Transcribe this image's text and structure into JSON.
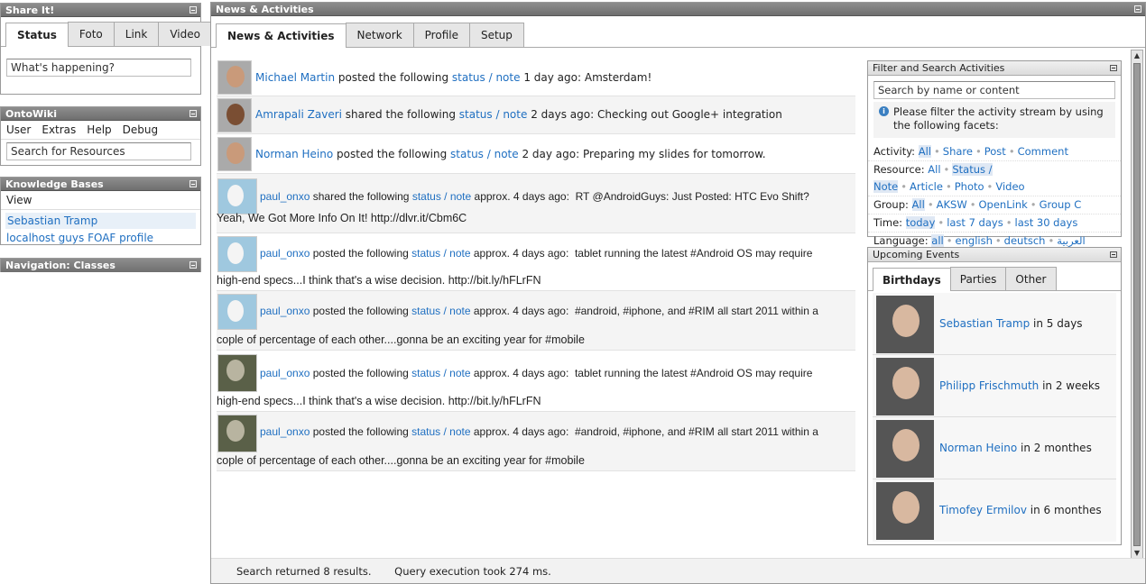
{
  "share": {
    "title": "Share It!",
    "tabs": [
      "Status",
      "Foto",
      "Link",
      "Video"
    ],
    "input_value": "What's happening?"
  },
  "ontowiki": {
    "title": "OntoWiki",
    "menu": [
      "User",
      "Extras",
      "Help",
      "Debug"
    ],
    "search_value": "Search for Resources"
  },
  "kb": {
    "title": "Knowledge Bases",
    "view": "View",
    "items": [
      "Sebastian Tramp",
      "localhost guys FOAF profile"
    ]
  },
  "nav": {
    "title": "Navigation: Classes"
  },
  "news": {
    "title": "News & Activities",
    "tabs": [
      "News & Activities",
      "Network",
      "Profile",
      "Setup"
    ],
    "feed": [
      {
        "user": "Michael Martin",
        "verb": "posted the following",
        "link": "status / note",
        "time": "1 day ago:",
        "text": "Amsterdam!"
      },
      {
        "user": "Amrapali Zaveri",
        "verb": "shared the following",
        "link": "status / note",
        "time": "2 days ago:",
        "text": "Checking out Google+ integration"
      },
      {
        "user": "Norman Heino",
        "verb": "posted the following",
        "link": "status / note",
        "time": "2 day ago:",
        "text": "Preparing my slides for tomorrow."
      },
      {
        "user": "paul_onxo",
        "verb": "shared the following",
        "link": "status / note",
        "time": "approx. 4 days ago:",
        "text": "RT @AndroidGuys: Just Posted: HTC Evo Shift?",
        "text2": "Yeah, We Got More Info On It! http://dlvr.it/Cbm6C"
      },
      {
        "user": "paul_onxo",
        "verb": "posted the following",
        "link": "status / note",
        "time": "approx. 4 days ago:",
        "text": "tablet running the latest #Android OS may require",
        "text2": "high-end specs...I think that's a wise decision. http://bit.ly/hFLrFN"
      },
      {
        "user": "paul_onxo",
        "verb": "posted the following",
        "link": "status / note",
        "time": "approx. 4 days ago:",
        "text": "#android, #iphone, and #RIM all start 2011 within a",
        "text2": "cople of percentage of each other....gonna be an exciting year for #mobile"
      },
      {
        "user": "paul_onxo",
        "verb": "posted the following",
        "link": "status / note",
        "time": "approx. 4  days ago:",
        "text": "tablet running the latest #Android OS may require",
        "text2": "high-end specs...I think that's a wise decision. http://bit.ly/hFLrFN"
      },
      {
        "user": "paul_onxo",
        "verb": "posted the following",
        "link": "status / note",
        "time": "approx. 4 days ago:",
        "text": "#android, #iphone, and #RIM all start 2011 within a",
        "text2": "cople of percentage of each other....gonna be an exciting year for #mobile"
      }
    ],
    "status": {
      "results": "Search returned 8 results.",
      "query": "Query execution took 274 ms."
    }
  },
  "filter": {
    "title": "Filter and Search Activities",
    "search_value": "Search by name or content",
    "info": "Please filter the activity stream by using the following facets:",
    "facets": [
      {
        "label": "Activity:",
        "options": [
          "All",
          "Share",
          "Post",
          "Comment"
        ],
        "selected": 0
      },
      {
        "label": "Resource:",
        "options": [
          "All",
          "Status / Note",
          "Article",
          "Photo",
          "Video"
        ],
        "selected": 1
      },
      {
        "label": "Group:",
        "options": [
          "All",
          "AKSW",
          "OpenLink",
          "Group C"
        ],
        "selected": 0
      },
      {
        "label": "Time:",
        "options": [
          "today",
          "last 7 days",
          "last 30 days"
        ],
        "selected": 0
      },
      {
        "label": "Language:",
        "options": [
          "all",
          "english",
          "deutsch",
          "العربية"
        ],
        "selected": 0
      }
    ]
  },
  "events": {
    "title": "Upcoming Events",
    "tabs": [
      "Birthdays",
      "Parties",
      "Other"
    ],
    "items": [
      {
        "name": "Sebastian Tramp",
        "when": "in 5 days"
      },
      {
        "name": "Philipp Frischmuth",
        "when": "in 2 weeks"
      },
      {
        "name": "Norman Heino",
        "when": "in 2 monthes"
      },
      {
        "name": "Timofey Ermilov",
        "when": "in 6 monthes"
      }
    ]
  }
}
